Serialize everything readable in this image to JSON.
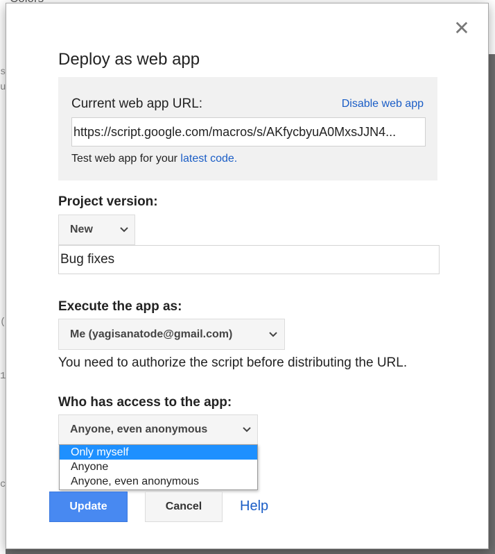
{
  "background": {
    "top_text": "Colors",
    "side_marks": [
      "s",
      "u",
      "(",
      "1",
      "c"
    ]
  },
  "dialog": {
    "title": "Deploy as web app",
    "close_icon": "close-icon"
  },
  "web_app_url": {
    "label": "Current web app URL:",
    "disable_link": "Disable web app",
    "url_value": "https://script.google.com/macros/s/AKfycbyuA0MxsJJN4...",
    "test_prefix": "Test web app for your ",
    "test_link": "latest code."
  },
  "project_version": {
    "label": "Project version:",
    "selected": "New",
    "description_value": "Bug fixes"
  },
  "execute_as": {
    "label": "Execute the app as:",
    "selected": "Me (yagisanatode@gmail.com)",
    "note": "You need to authorize the script before distributing the URL."
  },
  "access": {
    "label": "Who has access to the app:",
    "selected": "Anyone, even anonymous",
    "options": [
      "Only myself",
      "Anyone",
      "Anyone, even anonymous"
    ],
    "highlighted_option": "Only myself"
  },
  "buttons": {
    "update": "Update",
    "cancel": "Cancel",
    "help": "Help"
  },
  "colors": {
    "primary": "#4889f1",
    "link": "#1a5dc6",
    "highlight": "#1e90ff"
  }
}
